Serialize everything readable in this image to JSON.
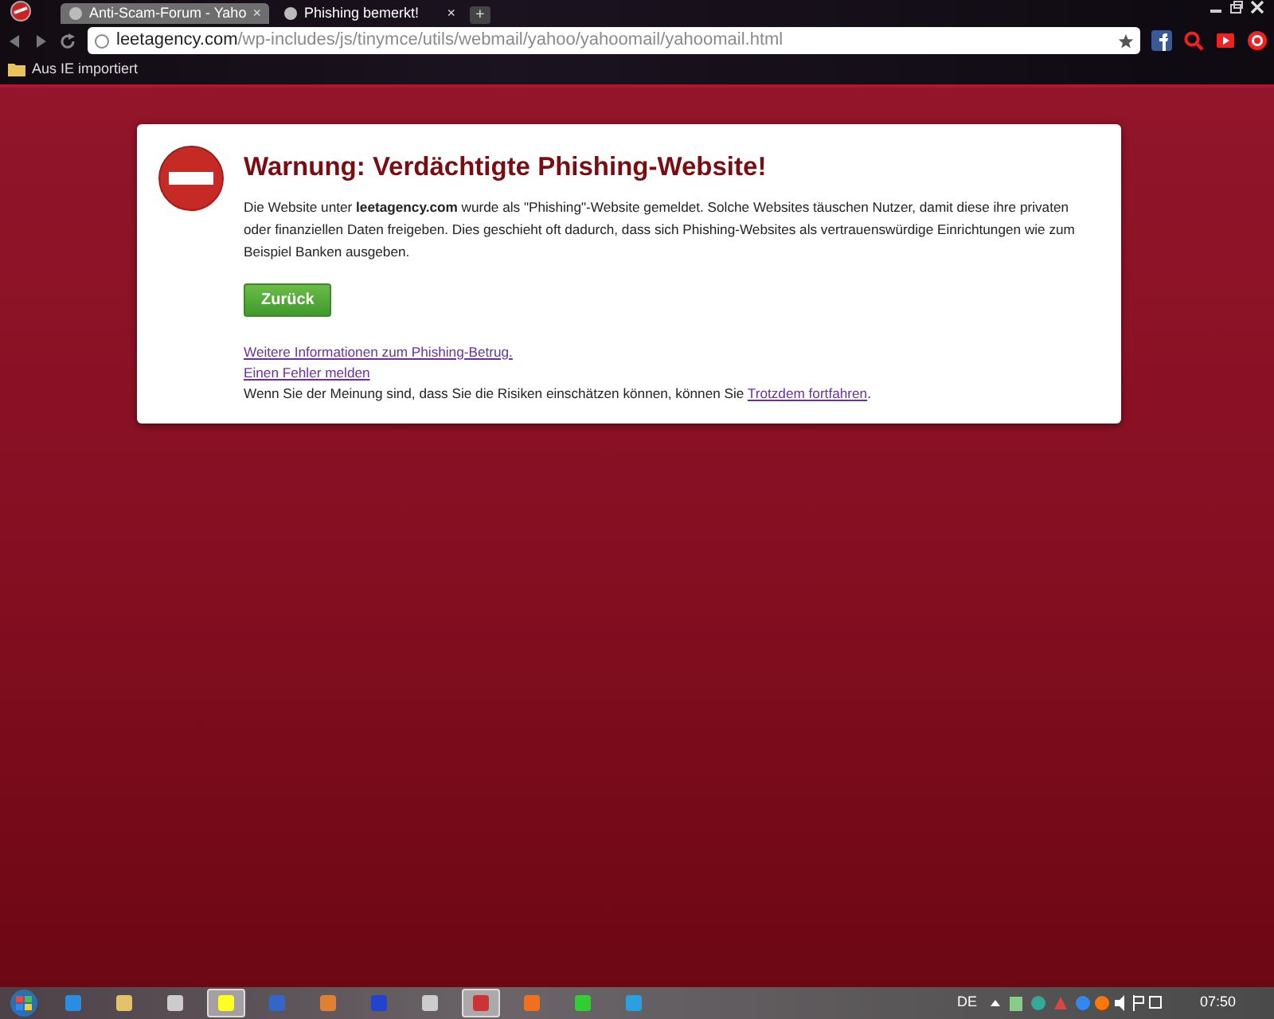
{
  "tabs": [
    {
      "title": "Anti-Scam-Forum - Yaho",
      "selected": false,
      "close": "×"
    },
    {
      "title": "Phishing bemerkt!",
      "selected": true,
      "close": "×"
    }
  ],
  "new_tab": "+",
  "address": {
    "domain": "leetagency.com",
    "path": "/wp-includes/js/tinymce/utils/webmail/yahoo/yahoomail/yahoomail.html"
  },
  "bookmarks": [
    {
      "label": "Aus IE importiert"
    }
  ],
  "warning": {
    "title": "Warnung: Verdächtigte Phishing-Website!",
    "message": "Die Website unter **leetagency.com** wurde als \"Phishing\"-Website gemeldet. Solche Websites täuschen Nutzer, damit diese ihre privaten oder finanziellen Daten freigeben. Dies geschieht oft dadurch, dass sich Phishing-Websites als vertrauenswürdige Einrichtungen wie zum Beispiel Banken ausgeben.",
    "button": "Zurück",
    "links": [
      "Weitere Informationen zum Phishing-Betrug.",
      "Einen Fehler melden"
    ],
    "proceed": {
      "before": "Wenn Sie der Meinung sind, dass Sie die Risiken einschätzen können, können Sie ",
      "link": "Trotzdem fortfahren",
      "after": "."
    }
  },
  "taskbar": {
    "apps": [
      {
        "selected": false
      },
      {
        "selected": false
      },
      {
        "selected": false
      },
      {
        "selected": true
      },
      {
        "selected": false
      },
      {
        "selected": false
      },
      {
        "selected": false
      },
      {
        "selected": false
      },
      {
        "selected": true
      },
      {
        "selected": false
      },
      {
        "selected": false
      },
      {
        "selected": false
      }
    ],
    "language": "DE",
    "clock": "07:50"
  }
}
